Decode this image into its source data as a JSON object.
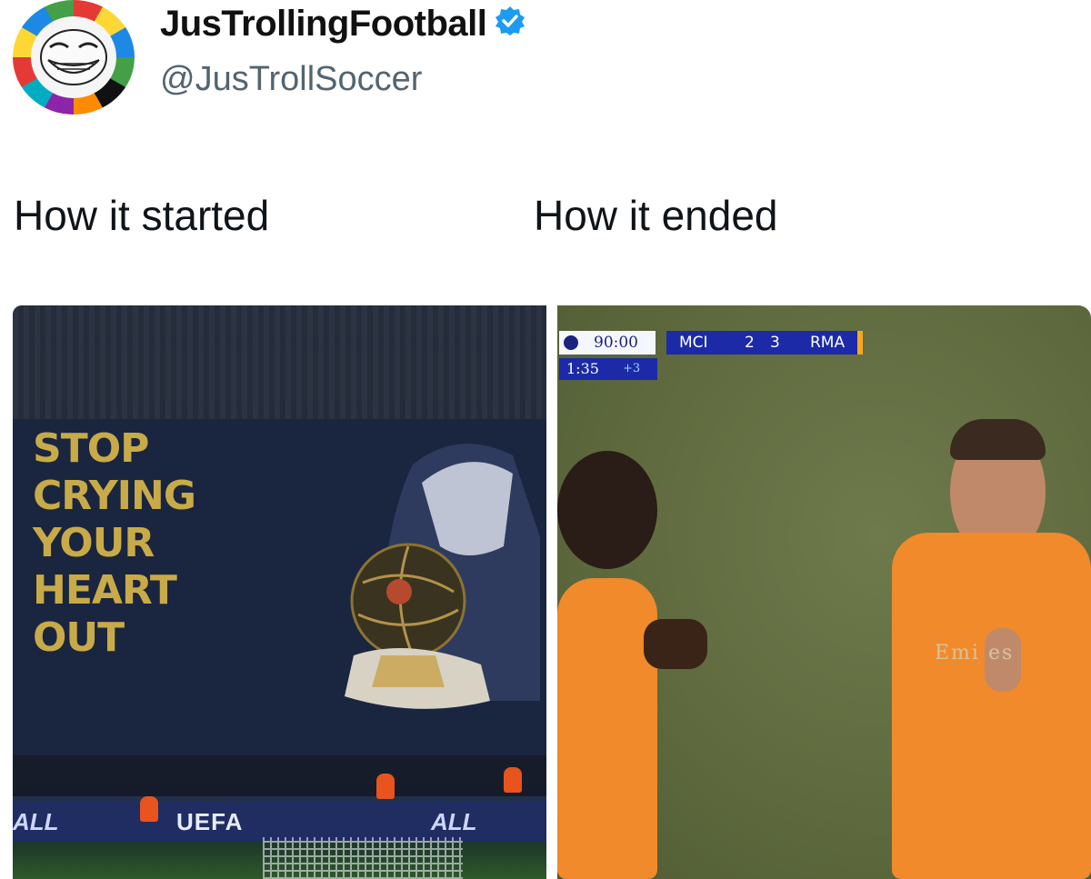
{
  "header": {
    "display_name": "JusTrollingFootball",
    "handle": "@JusTrollSoccer",
    "verified_icon": "verified-badge-icon",
    "accent_color": "#1d9bf0"
  },
  "captions": {
    "left": "How it started",
    "right": "How it ended"
  },
  "left_image": {
    "banner_lines": [
      "STOP",
      "CRYING",
      "YOUR",
      "HEART",
      "OUT"
    ],
    "board_text_left": "ALL",
    "board_text_center": "UEFA",
    "board_text_right": "ALL"
  },
  "right_image": {
    "scorebug": {
      "clock": "90:00",
      "home": "MCI",
      "home_score": "2",
      "away_score": "3",
      "away": "RMA",
      "added_elapsed": "1:35",
      "added_time": "+3"
    },
    "shirt_text": "Emi  es"
  }
}
